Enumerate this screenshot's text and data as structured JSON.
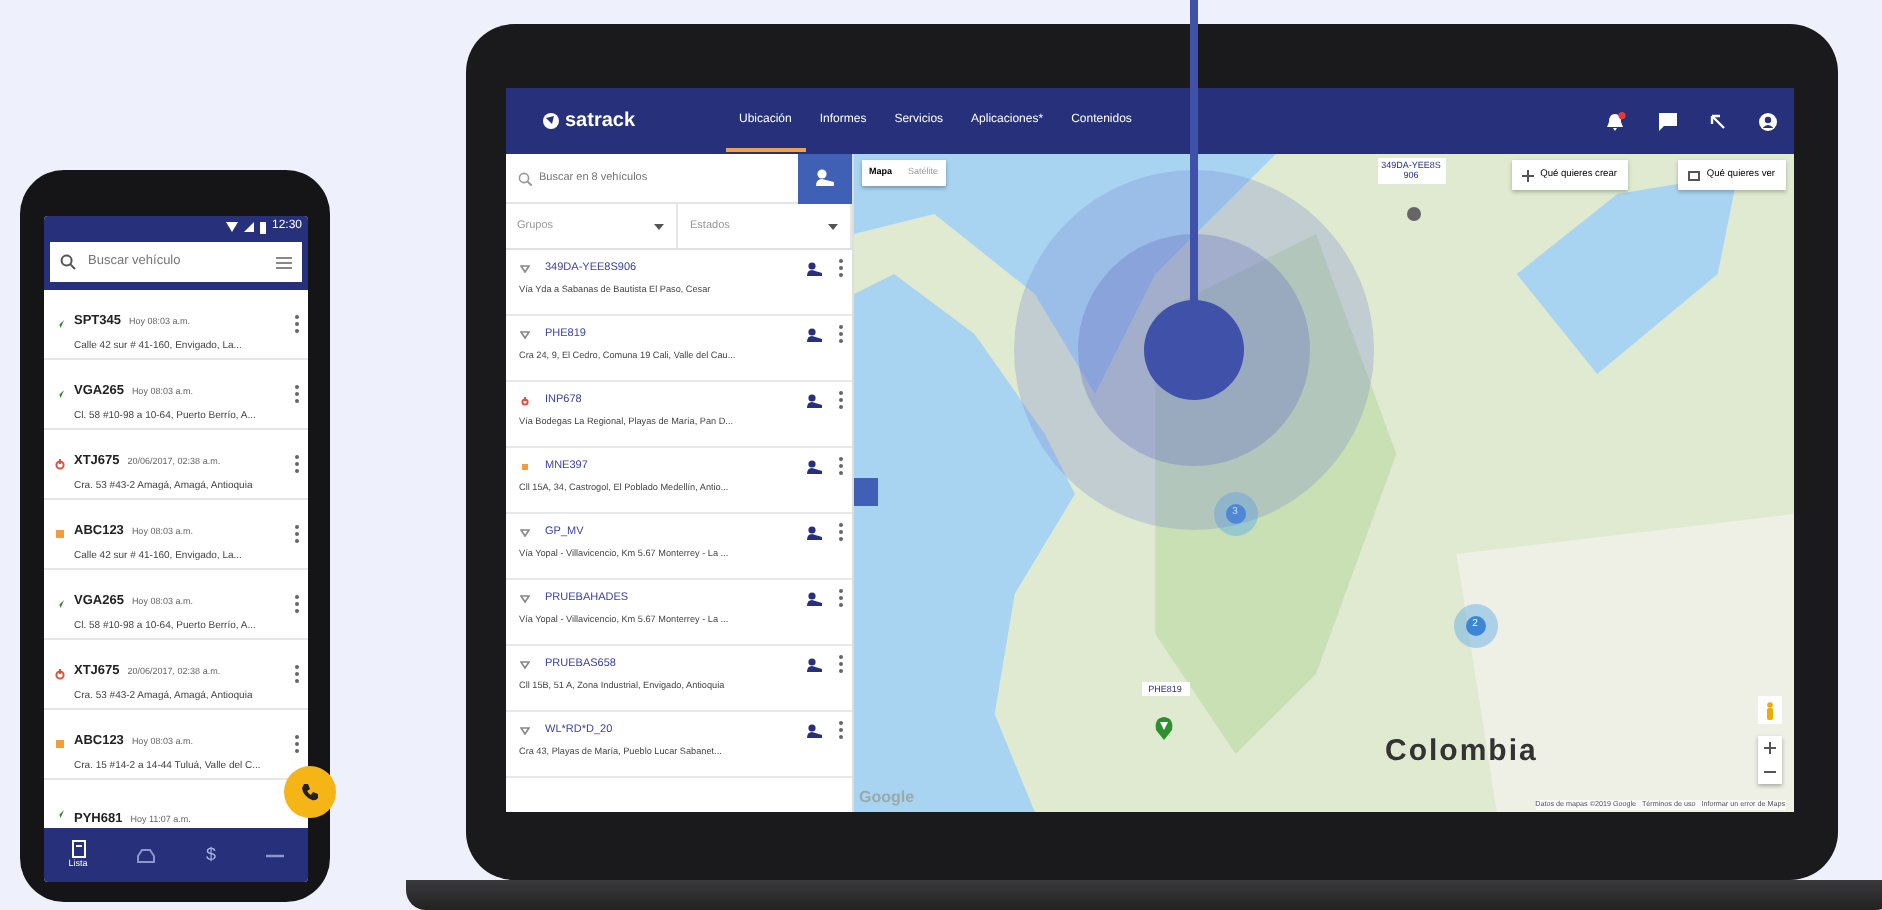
{
  "phone": {
    "status_time": "12:30",
    "search": {
      "placeholder": "Buscar vehículo"
    },
    "vehicles": [
      {
        "plate": "SPT345",
        "time": "Hoy 08:03 a.m.",
        "address": "Calle 42 sur # 41-160, Envigado, La...",
        "kind": "moving"
      },
      {
        "plate": "VGA265",
        "time": "Hoy 08:03 a.m.",
        "address": "Cl. 58 #10-98 a 10-64, Puerto Berrío, A...",
        "kind": "moving"
      },
      {
        "plate": "XTJ675",
        "time": "20/06/2017, 02:38 a.m.",
        "address": "Cra. 53 #43-2 Amagá, Amagá, Antioquia",
        "kind": "off"
      },
      {
        "plate": "ABC123",
        "time": "Hoy 08:03 a.m.",
        "address": "Calle 42 sur # 41-160, Envigado, La...",
        "kind": "stopped"
      },
      {
        "plate": "VGA265",
        "time": "Hoy 08:03 a.m.",
        "address": "Cl. 58 #10-98 a 10-64, Puerto Berrío, A...",
        "kind": "moving"
      },
      {
        "plate": "XTJ675",
        "time": "20/06/2017, 02:38 a.m.",
        "address": "Cra. 53 #43-2 Amagá, Amagá, Antioquia",
        "kind": "off"
      },
      {
        "plate": "ABC123",
        "time": "Hoy 08:03 a.m.",
        "address": "Cra. 15 #14-2 a 14-44 Tuluá, Valle del C...",
        "kind": "stopped"
      },
      {
        "plate": "PYH681",
        "time": "Hoy 11:07 a.m.",
        "kind": "moving"
      }
    ],
    "nav": [
      {
        "kind": "list",
        "label": "Lista",
        "selected": true
      },
      {
        "kind": "car",
        "selected": false
      },
      {
        "kind": "money",
        "glyph": "$",
        "selected": false
      },
      {
        "kind": "more",
        "selected": false
      }
    ]
  },
  "laptop": {
    "brand": "satrack",
    "tabs": [
      {
        "label": "Ubicación",
        "selected": true
      },
      {
        "label": "Informes",
        "selected": false
      },
      {
        "label": "Servicios",
        "selected": false
      },
      {
        "label": "Aplicaciones*",
        "selected": false
      },
      {
        "label": "Contenidos",
        "selected": false
      }
    ],
    "has_notifications": true,
    "sidebar": {
      "search": {
        "placeholder": "Buscar en 8 vehículos"
      },
      "filters": [
        {
          "placeholder": "Grupos"
        },
        {
          "placeholder": "Estados"
        }
      ],
      "vehicles": [
        {
          "name": "349DA-YEE8S906",
          "address": "Vía Yda a Sabanas de Bautista El Paso, Cesar",
          "kind": "idle"
        },
        {
          "name": "PHE819",
          "address": "Cra 24, 9, El Cedro, Comuna 19 Cali, Valle del Cau...",
          "kind": "idle"
        },
        {
          "name": "INP678",
          "address": "Vía Bodegas La Regional, Playas de María, Pan D...",
          "kind": "off"
        },
        {
          "name": "MNE397",
          "address": "Cll 15A, 34, Castrogol, El Poblado Medellín, Antio...",
          "kind": "stopped"
        },
        {
          "name": "GP_MV",
          "address": "Vía Yopal - Villavicencio, Km 5.67 Monterrey - La ...",
          "kind": "idle"
        },
        {
          "name": "PRUEBAHADES",
          "address": "Vía Yopal - Villavicencio, Km 5.67 Monterrey - La ...",
          "kind": "idle"
        },
        {
          "name": "PRUEBAS658",
          "address": "Cll 15B, 51 A, Zona Industrial, Envigado, Antioquia",
          "kind": "idle"
        },
        {
          "name": "WL*RD*D_20",
          "address": "Cra 43, Playas de María, Pueblo Lucar Sabanet...",
          "kind": "idle"
        }
      ]
    },
    "map": {
      "map_types": [
        {
          "label": "Mapa",
          "selected": true
        },
        {
          "label": "Satélite",
          "selected": false
        }
      ],
      "actions": [
        "Qué quieres crear",
        "Qué quieres ver"
      ],
      "markers": [
        {
          "kind": "vehicle",
          "label": "349DA-YEE8S906"
        },
        {
          "kind": "cluster",
          "count": "3"
        },
        {
          "kind": "cluster",
          "count": "2"
        },
        {
          "kind": "vehicle_moving",
          "label": "PHE819"
        }
      ],
      "country_label": "Colombia",
      "logo": "Google",
      "attribution": "Datos de mapas ©2019 Google   Términos de uso   Informar un error de Maps"
    }
  }
}
